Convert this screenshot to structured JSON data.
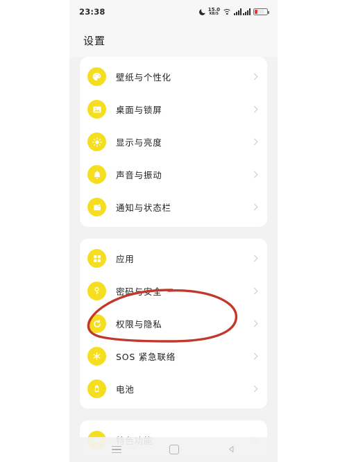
{
  "status_bar": {
    "time": "23:38",
    "network_speed_value": "15.0",
    "network_speed_unit": "KB/S",
    "battery_percent": "18",
    "icons": [
      "moon-icon",
      "network-speed",
      "wifi-icon",
      "signal-icon",
      "battery-icon"
    ]
  },
  "header": {
    "title": "设置"
  },
  "cards": [
    {
      "items": [
        {
          "label": "壁纸与个性化",
          "icon": "palette-icon"
        },
        {
          "label": "桌面与锁屏",
          "icon": "image-icon"
        },
        {
          "label": "显示与亮度",
          "icon": "brightness-icon"
        },
        {
          "label": "声音与振动",
          "icon": "bell-icon"
        },
        {
          "label": "通知与状态栏",
          "icon": "notification-icon"
        }
      ]
    },
    {
      "items": [
        {
          "label": "应用",
          "icon": "grid-icon"
        },
        {
          "label": "密码与安全",
          "icon": "key-icon"
        },
        {
          "label": "权限与隐私",
          "icon": "privacy-icon"
        },
        {
          "label": "SOS 紧急联络",
          "icon": "sos-icon"
        },
        {
          "label": "电池",
          "icon": "battery-icon"
        }
      ]
    },
    {
      "items": [
        {
          "label": "特色功能",
          "icon": "feature-icon"
        }
      ]
    }
  ],
  "nav_bar": {
    "recents_label": "recents-button",
    "home_label": "home-button",
    "back_label": "back-button"
  },
  "annotation": {
    "type": "hand-drawn-ellipse",
    "color": "#c0392b",
    "target_label": "权限与隐私"
  },
  "theme": {
    "accent_yellow": "#f5de1f",
    "page_background": "#f2f2f2",
    "card_background": "#ffffff",
    "text_primary": "#1e1e1e",
    "chevron_gray": "#c8c8c8"
  }
}
